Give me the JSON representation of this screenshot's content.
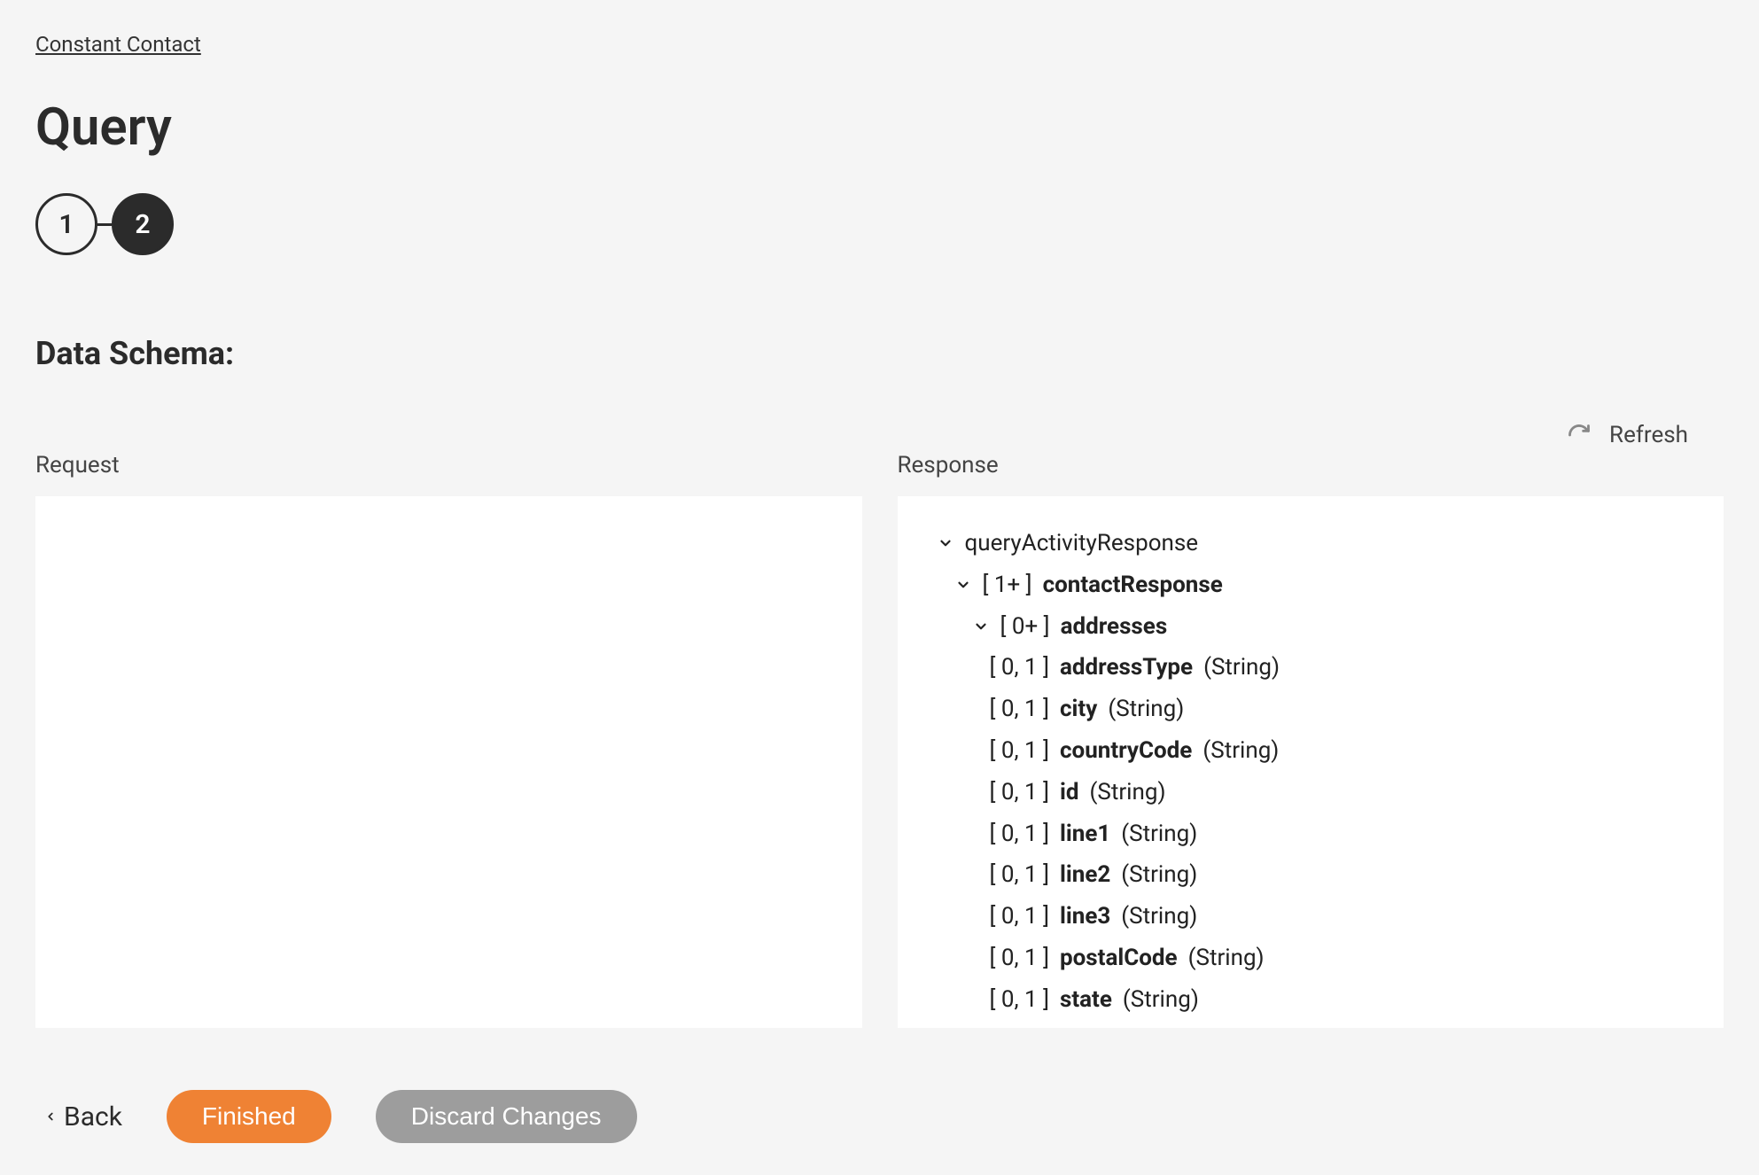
{
  "breadcrumb": "Constant Contact",
  "page_title": "Query",
  "stepper": {
    "step1": "1",
    "step2": "2"
  },
  "section_title": "Data Schema:",
  "refresh_label": "Refresh",
  "request_label": "Request",
  "response_label": "Response",
  "tree": {
    "root": {
      "label": "queryActivityResponse"
    },
    "contactResponse": {
      "card": "[ 1+ ]",
      "name": "contactResponse"
    },
    "addresses": {
      "card": "[ 0+ ]",
      "name": "addresses"
    },
    "fields": [
      {
        "card": "[ 0, 1 ]",
        "name": "addressType",
        "type": "(String)"
      },
      {
        "card": "[ 0, 1 ]",
        "name": "city",
        "type": "(String)"
      },
      {
        "card": "[ 0, 1 ]",
        "name": "countryCode",
        "type": "(String)"
      },
      {
        "card": "[ 0, 1 ]",
        "name": "id",
        "type": "(String)"
      },
      {
        "card": "[ 0, 1 ]",
        "name": "line1",
        "type": "(String)"
      },
      {
        "card": "[ 0, 1 ]",
        "name": "line2",
        "type": "(String)"
      },
      {
        "card": "[ 0, 1 ]",
        "name": "line3",
        "type": "(String)"
      },
      {
        "card": "[ 0, 1 ]",
        "name": "postalCode",
        "type": "(String)"
      },
      {
        "card": "[ 0, 1 ]",
        "name": "state",
        "type": "(String)"
      }
    ]
  },
  "footer": {
    "back": "Back",
    "finished": "Finished",
    "discard": "Discard Changes"
  }
}
